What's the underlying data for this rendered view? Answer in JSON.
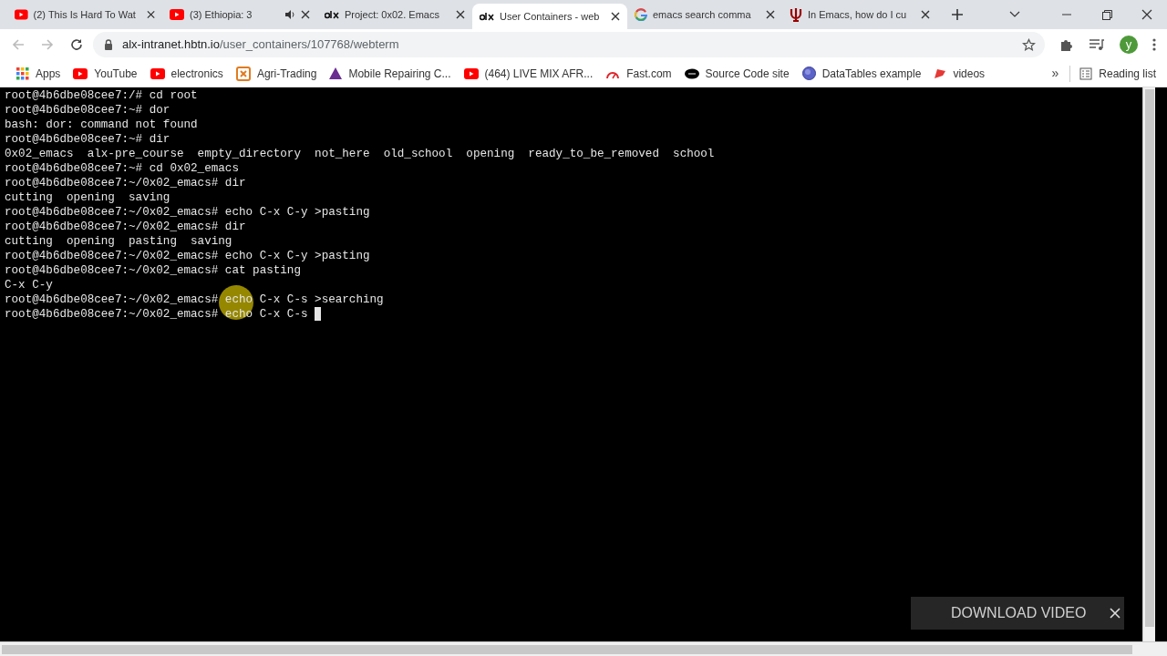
{
  "tabs": [
    {
      "title": "(2) This Is Hard To Wat",
      "kind": "youtube",
      "selected": false,
      "audio": false
    },
    {
      "title": "(3) Ethiopia: 3",
      "kind": "youtube",
      "selected": false,
      "audio": true
    },
    {
      "title": "Project: 0x02. Emacs",
      "kind": "alx",
      "selected": false,
      "audio": false
    },
    {
      "title": "User Containers - web",
      "kind": "alx",
      "selected": true,
      "audio": false
    },
    {
      "title": "emacs search comma",
      "kind": "google",
      "selected": false,
      "audio": false
    },
    {
      "title": "In Emacs, how do I cu",
      "kind": "trident",
      "selected": false,
      "audio": false
    }
  ],
  "address": {
    "domain": "alx-intranet.hbtn.io",
    "path": "/user_containers/107768/webterm"
  },
  "profile": "y",
  "bookmarks": [
    {
      "label": "Apps",
      "kind": "apps"
    },
    {
      "label": "YouTube",
      "kind": "youtube"
    },
    {
      "label": "electronics",
      "kind": "youtube"
    },
    {
      "label": "Agri-Trading",
      "kind": "square"
    },
    {
      "label": "Mobile Repairing C...",
      "kind": "triangle"
    },
    {
      "label": "(464) LIVE MIX AFR...",
      "kind": "youtube"
    },
    {
      "label": "Fast.com",
      "kind": "gauge"
    },
    {
      "label": "Source Code site",
      "kind": "oval"
    },
    {
      "label": "DataTables example",
      "kind": "globe"
    },
    {
      "label": "videos",
      "kind": "flag"
    }
  ],
  "more_bookmarks": "»",
  "reading_list": "Reading list",
  "terminal": {
    "lines": [
      {
        "text": "root@4b6dbe08cee7:/# cd root",
        "cursor": false
      },
      {
        "text": "root@4b6dbe08cee7:~# dor",
        "cursor": false
      },
      {
        "text": "bash: dor: command not found",
        "cursor": false
      },
      {
        "text": "root@4b6dbe08cee7:~# dir",
        "cursor": false
      },
      {
        "text": "0x02_emacs  alx-pre_course  empty_directory  not_here  old_school  opening  ready_to_be_removed  school",
        "cursor": false
      },
      {
        "text": "root@4b6dbe08cee7:~# cd 0x02_emacs",
        "cursor": false
      },
      {
        "text": "root@4b6dbe08cee7:~/0x02_emacs# dir",
        "cursor": false
      },
      {
        "text": "cutting  opening  saving",
        "cursor": false
      },
      {
        "text": "root@4b6dbe08cee7:~/0x02_emacs# echo C-x C-y >pasting",
        "cursor": false
      },
      {
        "text": "root@4b6dbe08cee7:~/0x02_emacs# dir",
        "cursor": false
      },
      {
        "text": "cutting  opening  pasting  saving",
        "cursor": false
      },
      {
        "text": "root@4b6dbe08cee7:~/0x02_emacs# echo C-x C-y >pasting",
        "cursor": false
      },
      {
        "text": "root@4b6dbe08cee7:~/0x02_emacs# cat pasting",
        "cursor": false
      },
      {
        "text": "C-x C-y",
        "cursor": false
      },
      {
        "text": "root@4b6dbe08cee7:~/0x02_emacs# echo C-x C-s >searching",
        "cursor": false
      },
      {
        "text": "root@4b6dbe08cee7:~/0x02_emacs# echo C-x C-s ",
        "cursor": true
      }
    ]
  },
  "overlay": {
    "label": "DOWNLOAD VIDEO"
  }
}
